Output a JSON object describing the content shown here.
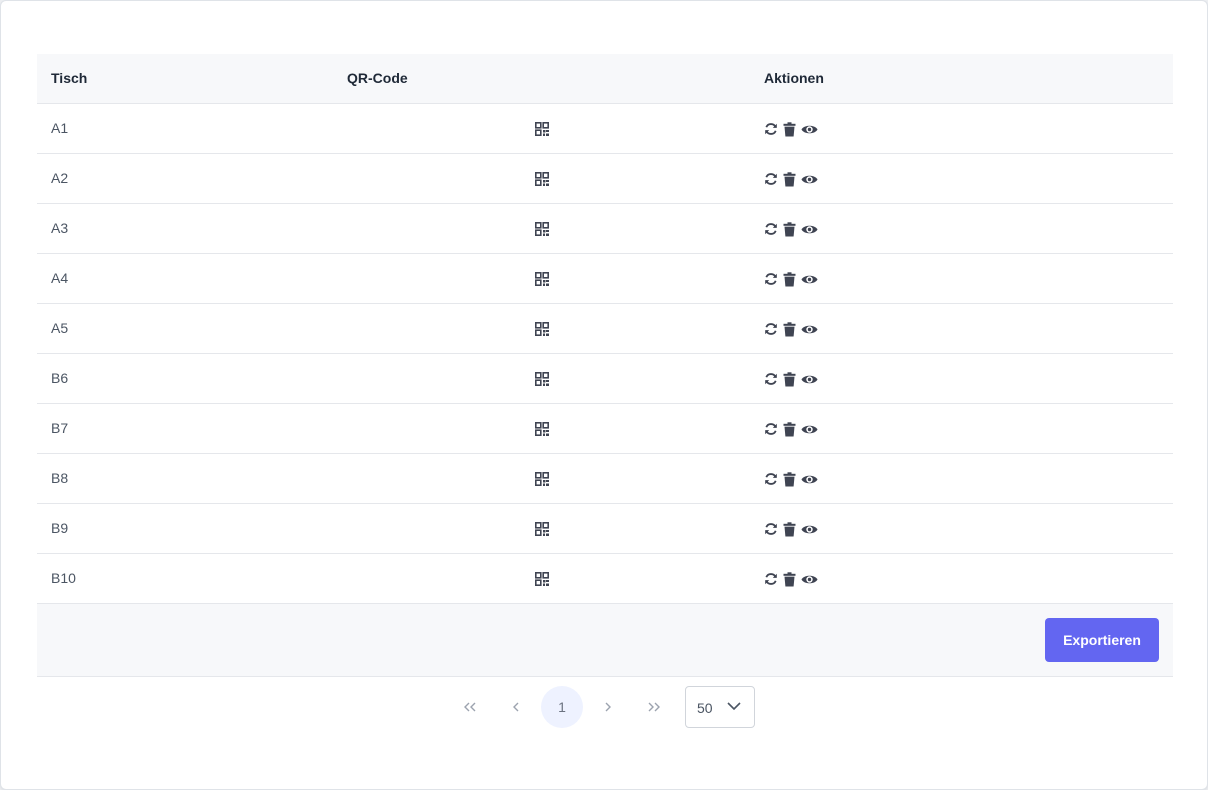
{
  "table": {
    "headers": {
      "name": "Tisch",
      "qr": "QR-Code",
      "actions": "Aktionen"
    },
    "rows": [
      {
        "name": "A1"
      },
      {
        "name": "A2"
      },
      {
        "name": "A3"
      },
      {
        "name": "A4"
      },
      {
        "name": "A5"
      },
      {
        "name": "B6"
      },
      {
        "name": "B7"
      },
      {
        "name": "B8"
      },
      {
        "name": "B9"
      },
      {
        "name": "B10"
      }
    ],
    "row_icons": {
      "qr": "qrcode-icon",
      "actions": [
        "refresh-icon",
        "trash-icon",
        "eye-icon"
      ]
    }
  },
  "footer": {
    "export_label": "Exportieren"
  },
  "pagination": {
    "first": "«",
    "prev": "‹",
    "current_page": "1",
    "next": "›",
    "last": "»",
    "rows_per_page": "50"
  },
  "colors": {
    "accent": "#6366f1",
    "icon": "#3f4452"
  }
}
